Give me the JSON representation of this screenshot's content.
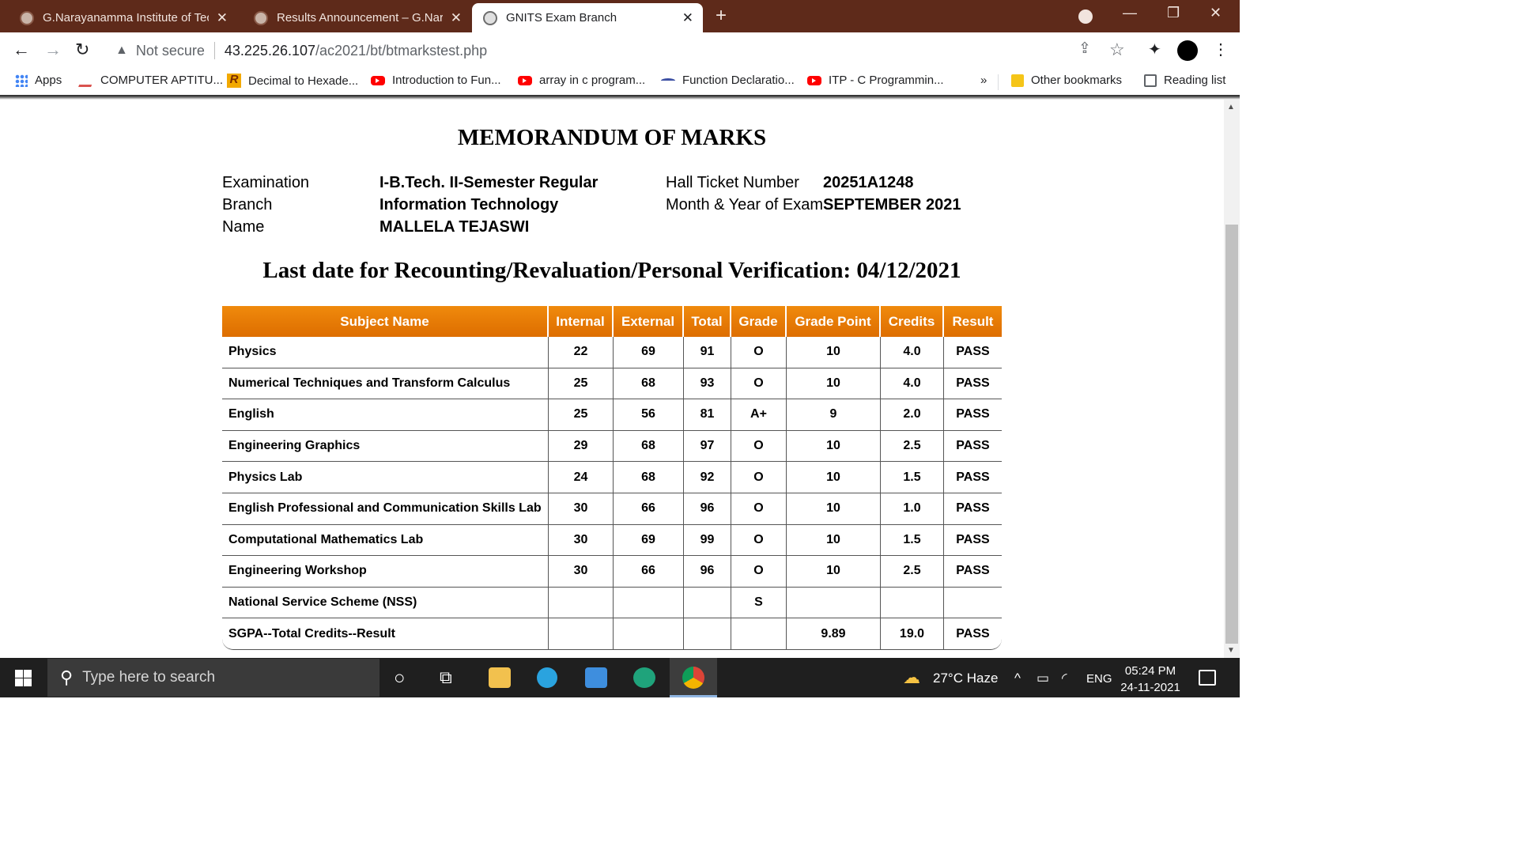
{
  "browser": {
    "tabs": [
      {
        "title": "G.Narayanamma Institute of Tech",
        "active": false
      },
      {
        "title": "Results Announcement – G.Naray",
        "active": false
      },
      {
        "title": "GNITS Exam Branch",
        "active": true
      }
    ],
    "security_label": "Not secure",
    "url_host": "43.225.26.107",
    "url_path": "/ac2021/bt/btmarkstest.php",
    "bookmarks": [
      {
        "label": "Apps",
        "icon": "apps-grid-icon"
      },
      {
        "label": "COMPUTER APTITU...",
        "icon": "aptitude-icon"
      },
      {
        "label": "Decimal to Hexade...",
        "icon": "r-logo-icon"
      },
      {
        "label": "Introduction to Fun...",
        "icon": "youtube-icon"
      },
      {
        "label": "array in c program...",
        "icon": "youtube-icon"
      },
      {
        "label": "Function Declaratio...",
        "icon": "site-icon"
      },
      {
        "label": "ITP - C Programmin...",
        "icon": "youtube-icon"
      }
    ],
    "overflow_label": "»",
    "other_bookmarks": "Other bookmarks",
    "reading_list": "Reading list"
  },
  "memo": {
    "title": "MEMORANDUM OF MARKS",
    "examination_label": "Examination",
    "examination_value": "I-B.Tech. II-Semester Regular",
    "branch_label": "Branch",
    "branch_value": "Information Technology",
    "name_label": "Name",
    "name_value": "MALLELA TEJASWI",
    "hall_ticket_label": "Hall Ticket Number",
    "hall_ticket_value": "20251A1248",
    "month_year_label": "Month & Year of Exam",
    "month_year_value": "SEPTEMBER 2021",
    "recount_notice": "Last date for Recounting/Revaluation/Personal Verification: 04/12/2021"
  },
  "marks_table": {
    "headers": [
      "Subject Name",
      "Internal",
      "External",
      "Total",
      "Grade",
      "Grade Point",
      "Credits",
      "Result"
    ],
    "rows": [
      [
        "Physics",
        "22",
        "69",
        "91",
        "O",
        "10",
        "4.0",
        "PASS"
      ],
      [
        "Numerical Techniques and Transform Calculus",
        "25",
        "68",
        "93",
        "O",
        "10",
        "4.0",
        "PASS"
      ],
      [
        "English",
        "25",
        "56",
        "81",
        "A+",
        "9",
        "2.0",
        "PASS"
      ],
      [
        "Engineering Graphics",
        "29",
        "68",
        "97",
        "O",
        "10",
        "2.5",
        "PASS"
      ],
      [
        "Physics Lab",
        "24",
        "68",
        "92",
        "O",
        "10",
        "1.5",
        "PASS"
      ],
      [
        "English Professional and Communication Skills Lab",
        "30",
        "66",
        "96",
        "O",
        "10",
        "1.0",
        "PASS"
      ],
      [
        "Computational Mathematics Lab",
        "30",
        "69",
        "99",
        "O",
        "10",
        "1.5",
        "PASS"
      ],
      [
        "Engineering Workshop",
        "30",
        "66",
        "96",
        "O",
        "10",
        "2.5",
        "PASS"
      ],
      [
        "National Service Scheme (NSS)",
        "",
        "",
        "",
        "S",
        "",
        "",
        ""
      ]
    ],
    "summary": [
      "SGPA--Total Credits--Result",
      "",
      "",
      "",
      "",
      "9.89",
      "19.0",
      "PASS"
    ]
  },
  "taskbar": {
    "search_placeholder": "Type here to search",
    "weather": "27°C  Haze",
    "language": "ENG",
    "time": "05:24 PM",
    "date": "24-11-2021"
  },
  "colors": {
    "tab_bar": "#5e2a1a",
    "table_header": "#e77b06",
    "taskbar": "#1f1f1f"
  }
}
